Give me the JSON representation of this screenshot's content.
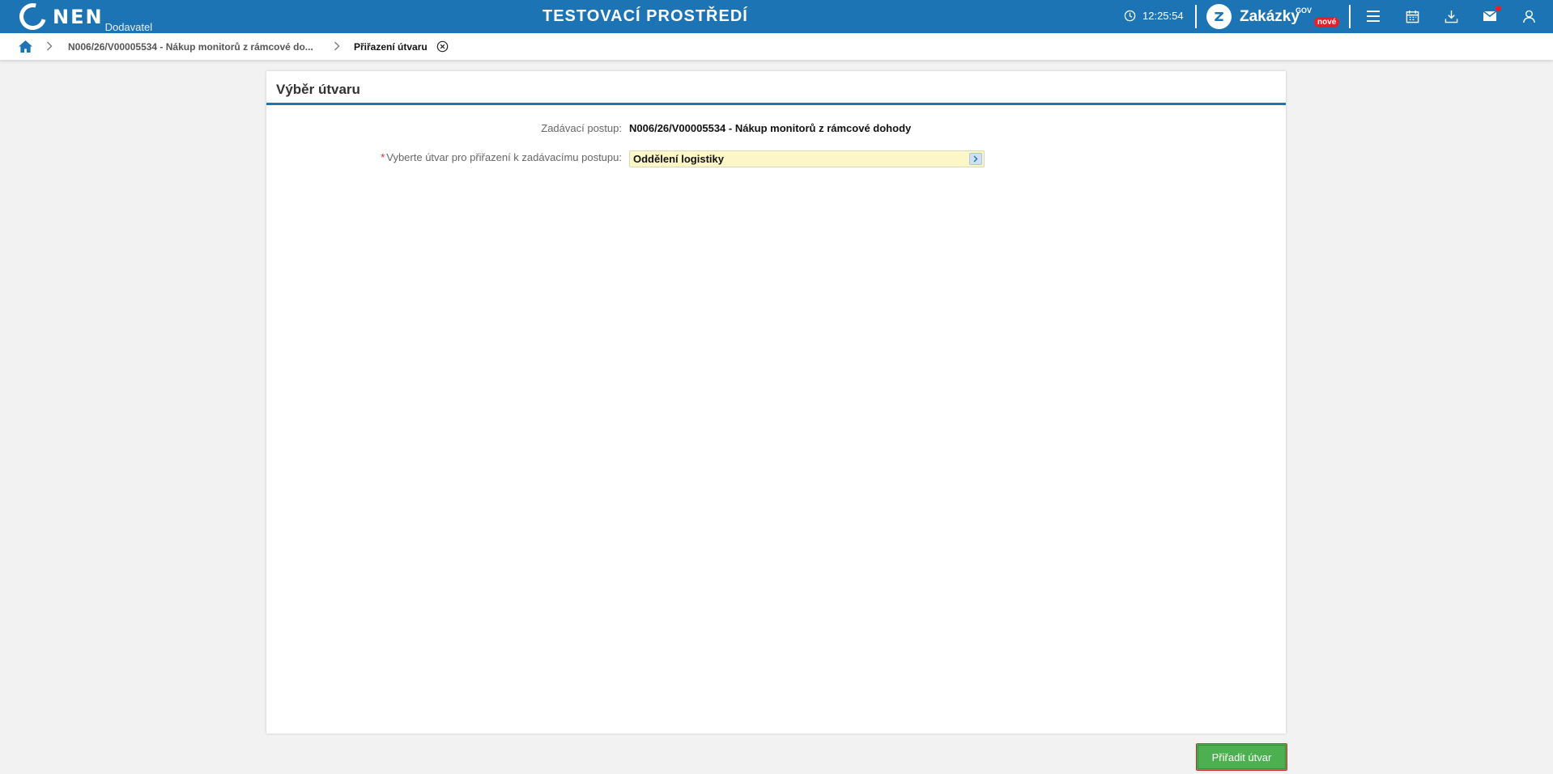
{
  "header": {
    "logo_text": "NEN",
    "logo_sub": "Dodavatel",
    "environment_title": "TESTOVACÍ PROSTŘEDÍ",
    "clock": "12:25:54",
    "zakazky_label": "Zakázky",
    "zakazky_gov": "GOV",
    "zakazky_badge": "nové",
    "icons": [
      "menu-icon",
      "calendar-icon",
      "download-icon",
      "mail-icon",
      "user-icon"
    ],
    "accent_color": "#1c74b4"
  },
  "breadcrumb": {
    "items": [
      {
        "label": "N006/26/V00005534 - Nákup monitorů z rámcové do..."
      },
      {
        "label": "Přiřazení útvaru"
      }
    ]
  },
  "panel": {
    "title": "Výběr útvaru",
    "procedure_label": "Zadávací postup:",
    "procedure_value": "N006/26/V00005534 - Nákup monitorů z rámcové dohody",
    "unit_required_mark": "*",
    "unit_label": "Vyberte útvar pro přiřazení k zadávacímu postupu:",
    "unit_value": "Oddělení logistiky"
  },
  "actions": {
    "assign_label": "Přiřadit útvar",
    "assign_color": "#4caf50"
  }
}
